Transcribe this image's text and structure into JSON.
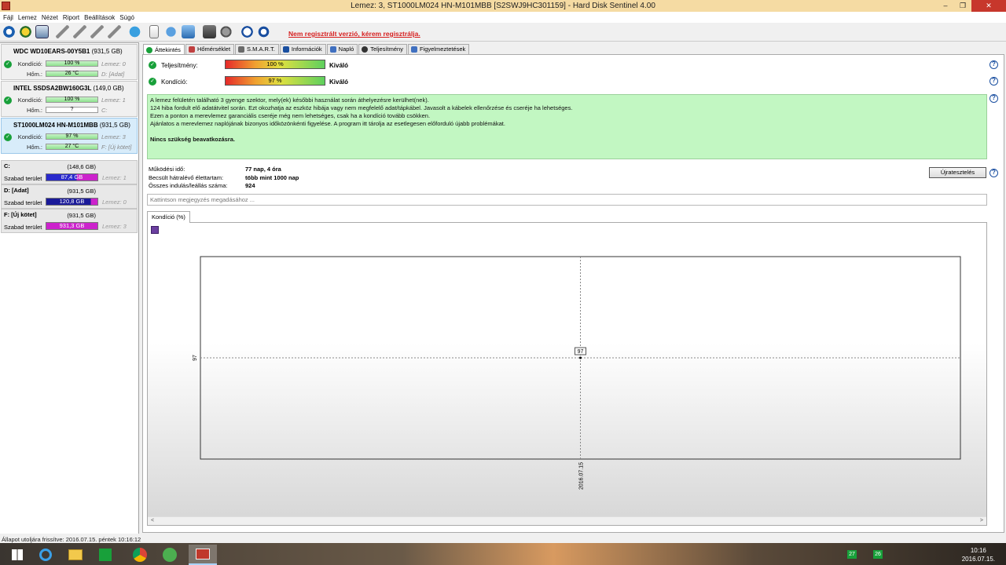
{
  "window": {
    "title": "Lemez: 3, ST1000LM024 HN-M101MBB [S2SWJ9HC301159]  -  Hard Disk Sentinel 4.00",
    "min": "–",
    "max": "❐",
    "close": "✕"
  },
  "menu": [
    "Fájl",
    "Lemez",
    "Nézet",
    "Riport",
    "Beállítások",
    "Súgó"
  ],
  "toolbar": {
    "icons": [
      "refresh-icon",
      "disk-info-icon",
      "disk-icon",
      "test-icon",
      "test-icon-2",
      "test-icon-3",
      "test-icon-4",
      "globe-icon",
      "report-icon",
      "send-icon",
      "network-icon",
      "settings-icon",
      "monitor-icon",
      "help-icon",
      "info-icon"
    ],
    "registration_text": "Nem regisztrált verzió, kérem regisztrálja."
  },
  "disks": [
    {
      "name": "WDC WD10EARS-00Y5B1",
      "size": "(931,5 GB)",
      "health_label": "Kondíció:",
      "health": "100 %",
      "health_pct": 100,
      "temp_label": "Hőm.:",
      "temp": "26 °C",
      "disk_no": "Lemez: 0",
      "drive": "D: [Adat]"
    },
    {
      "name": "INTEL SSDSA2BW160G3L",
      "size": "(149,0 GB)",
      "health_label": "Kondíció:",
      "health": "100 %",
      "health_pct": 100,
      "temp_label": "Hőm.:",
      "temp": "?",
      "disk_no": "Lemez: 1",
      "drive": "C:"
    },
    {
      "name": "ST1000LM024 HN-M101MBB",
      "size": "(931,5 GB)",
      "health_label": "Kondíció:",
      "health": "97 %",
      "health_pct": 97,
      "temp_label": "Hőm.:",
      "temp": "27 °C",
      "disk_no": "Lemez: 3",
      "drive": "F: [Új kötet]"
    }
  ],
  "partitions": [
    {
      "name": "C:",
      "size": "(148,6 GB)",
      "free_label": "Szabad terület",
      "free": "87,4 GB",
      "disk": "Lemez: 1",
      "color": "#2a2acc",
      "free_pct": 59
    },
    {
      "name": "D: [Adat]",
      "size": "(931,5 GB)",
      "free_label": "Szabad terület",
      "free": "120,8 GB",
      "disk": "Lemez: 0",
      "color": "#1a1a99",
      "free_pct": 13
    },
    {
      "name": "F: [Új kötet]",
      "size": "(931,5 GB)",
      "free_label": "Szabad terület",
      "free": "931,3 GB",
      "disk": "Lemez: 3",
      "color": "#cc22cc",
      "free_pct": 100
    }
  ],
  "status_bar": "Állapot utoljára frissítve: 2016.07.15. péntek 10:16:12",
  "tabs": [
    "Áttekintés",
    "Hőmérséklet",
    "S.M.A.R.T.",
    "Információk",
    "Napló",
    "Teljesítmény",
    "Figyelmeztetések"
  ],
  "tab_colors": [
    "#18a03a",
    "#c04040",
    "#6a6a6a",
    "#1a4fa0",
    "#4070c0",
    "#333333",
    "#4070c0"
  ],
  "overview": {
    "performance_label": "Teljesítmény:",
    "performance_value": "100 %",
    "performance_pct": 100,
    "performance_rating": "Kiváló",
    "health_label": "Kondíció:",
    "health_value": "97 %",
    "health_pct": 97,
    "health_rating": "Kiváló",
    "message_lines": [
      "A lemez felületén található 3 gyenge szektor, mely(ek) későbbi használat során áthelyezésre kerülhet(nek).",
      "124 hiba fordult elő adatátvitel során. Ezt okozhatja az eszköz hibája vagy nem megfelelő adat/tápkábel. Javasolt a kábelek ellenőrzése és cseréje ha lehetséges.",
      "Ezen a ponton a merevlemez garanciális cseréje még nem lehetséges, csak ha a kondíció tovább csökken.",
      "Ajánlatos a merevlemez naplójának bizonyos időközönkénti figyelése. A program itt tárolja az esetlegesen előforduló újabb problémákat."
    ],
    "message_conclusion": "Nincs szükség beavatkozásra.",
    "stats": [
      {
        "label": "Működési idő:",
        "value": "77 nap, 4 óra"
      },
      {
        "label": "Becsült hátralévő élettartam:",
        "value": "több mint 1000 nap"
      },
      {
        "label": "Összes indulás/leállás száma:",
        "value": "924"
      }
    ],
    "retest_button": "Újratesztelés",
    "note_placeholder": "Kattintson megjegyzés megadásához ..."
  },
  "chart_tab": "Kondíció  (%)",
  "chart_data": {
    "type": "line",
    "x": [
      "2016.07.15"
    ],
    "series": [
      {
        "values": [
          97
        ]
      }
    ],
    "point_label": "97",
    "ytick_labels": [
      "97"
    ],
    "xtick_labels": [
      "2016.07.15"
    ]
  },
  "scroll": {
    "left": "<",
    "right": ">"
  },
  "taskbar": {
    "apps": [
      "windows-start-icon",
      "ie-icon",
      "explorer-icon",
      "store-icon",
      "chrome-icon",
      "utorrent-icon",
      "hds-icon"
    ],
    "tray": [
      "27",
      "26"
    ],
    "time": "10:16",
    "date": "2016.07.15."
  }
}
